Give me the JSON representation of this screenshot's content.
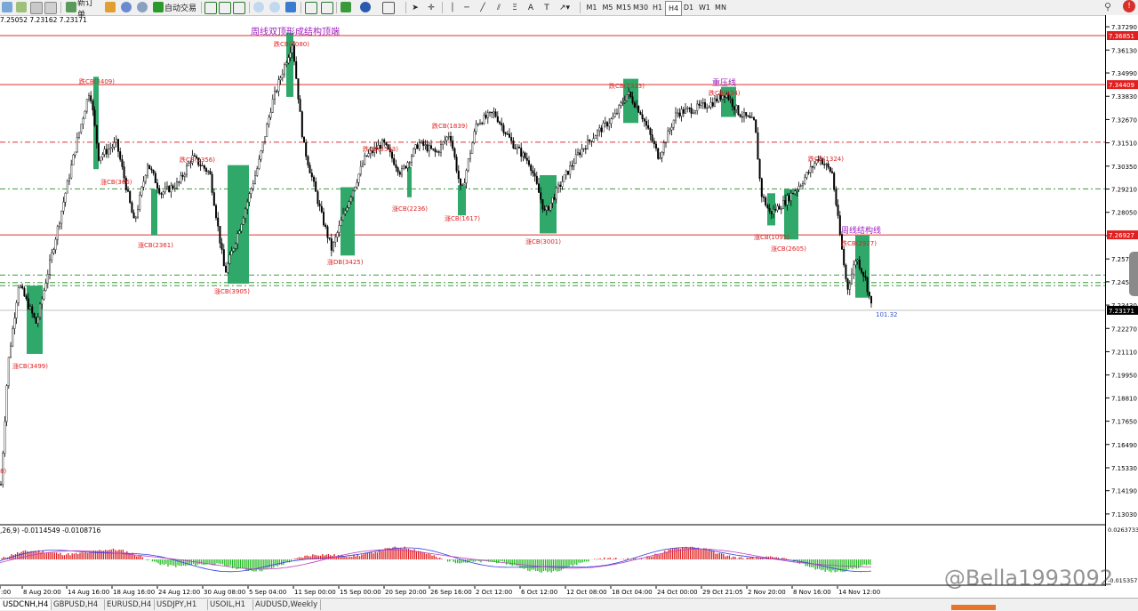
{
  "toolbar": {
    "new_order": "新订单",
    "auto_trade": "自动交易",
    "timeframes": [
      "M1",
      "M5",
      "M15",
      "M30",
      "H1",
      "H4",
      "D1",
      "W1",
      "MN"
    ],
    "search_icon": "search-icon",
    "alert_badge": "!"
  },
  "chart": {
    "ohlc": "7.25052 7.23162 7.23171",
    "indicator_label": ",26,9) -0.0114549 -0.0108716",
    "sell_label": "101.32",
    "price_axis": [
      "7.37290",
      "7.36130",
      "7.34990",
      "7.33830",
      "7.32670",
      "7.31510",
      "7.30350",
      "7.29210",
      "7.28050",
      "7.26890",
      "7.25730",
      "7.24590",
      "7.23430",
      "7.22270",
      "7.21110",
      "7.19950",
      "7.18810",
      "7.17650",
      "7.16490",
      "7.15330",
      "7.14190",
      "7.13030"
    ],
    "price_min": 7.1245,
    "price_max": 7.3787,
    "level_tags": [
      {
        "value": "7.36851",
        "price": 7.36851
      },
      {
        "value": "7.34409",
        "price": 7.34409
      },
      {
        "value": "7.26927",
        "price": 7.26927
      },
      {
        "value": "7.23171",
        "price": 7.23171
      }
    ],
    "sub_axis": [
      "0.0263733",
      "-0.015357"
    ],
    "time_labels": [
      ":00",
      "8 Aug 20:00",
      "14 Aug 16:00",
      "18 Aug 16:00",
      "24 Aug 12:00",
      "30 Aug 08:00",
      "5 Sep 04:00",
      "11 Sep 00:00",
      "15 Sep 00:00",
      "20 Sep 20:00",
      "26 Sep 16:00",
      "2 Oct 12:00",
      "6 Oct 12:00",
      "12 Oct 08:00",
      "18 Oct 04:00",
      "24 Oct 00:00",
      "29 Oct 21:05",
      "2 Nov 20:00",
      "8 Nov 16:00",
      "14 Nov 12:00"
    ],
    "annotations": [
      {
        "text": "周线双顶形成结构顶端",
        "color": "#a020c0"
      },
      {
        "text": "重压线",
        "color": "#a020c0"
      },
      {
        "text": "周线结构线",
        "color": "#a020c0"
      },
      {
        "text": "跌CB(3080)",
        "color": "#e02020"
      },
      {
        "text": "跌CB(3409)",
        "color": "#e02020"
      },
      {
        "text": "涨CB(3499)",
        "color": "#e02020"
      },
      {
        "text": "涨CB(366)",
        "color": "#e02020"
      },
      {
        "text": "跌CB(2356)",
        "color": "#e02020"
      },
      {
        "text": "涨CB(2361)",
        "color": "#e02020"
      },
      {
        "text": "涨CB(3905)",
        "color": "#e02020"
      },
      {
        "text": "涨DB(3425)",
        "color": "#e02020"
      },
      {
        "text": "跌CB(3543)",
        "color": "#e02020"
      },
      {
        "text": "涨CB(2236)",
        "color": "#e02020"
      },
      {
        "text": "跌CB(1839)",
        "color": "#e02020"
      },
      {
        "text": "涨CB(1617)",
        "color": "#e02020"
      },
      {
        "text": "涨CB(3001)",
        "color": "#e02020"
      },
      {
        "text": "跌CB(2333)",
        "color": "#e02020"
      },
      {
        "text": "跌CB(334)",
        "color": "#e02020"
      },
      {
        "text": "涨CB(1095)",
        "color": "#e02020"
      },
      {
        "text": "涨CB(2605)",
        "color": "#e02020"
      },
      {
        "text": "跌CB(1324)",
        "color": "#e02020"
      },
      {
        "text": "跌CB(2927)",
        "color": "#e02020"
      },
      {
        "text": "8)",
        "color": "#e02020"
      }
    ]
  },
  "tabs": [
    "USDCNH,H4",
    "GBPUSD,H4",
    "EURUSD,H4",
    "USDJPY,H1",
    "USOIL,H1",
    "AUDUSD,Weekly"
  ],
  "watermark": "@Bella1993092",
  "colors": {
    "box": "#2fa86a",
    "line_red": "#e03030",
    "line_green": "#3a9a3a",
    "macd_up": "#e02020",
    "macd_down": "#22bb22"
  }
}
